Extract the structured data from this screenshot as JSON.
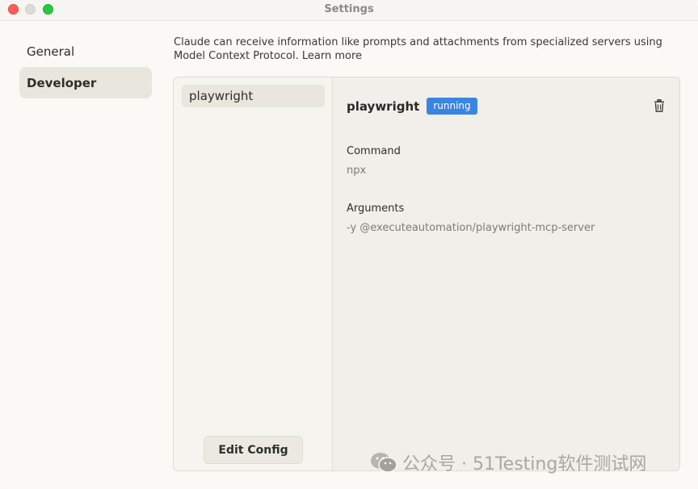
{
  "window": {
    "title": "Settings"
  },
  "sidebar": {
    "items": [
      {
        "label": "General",
        "active": false
      },
      {
        "label": "Developer",
        "active": true
      }
    ]
  },
  "intro": {
    "text": "Claude can receive information like prompts and attachments from specialized servers using Model Context Protocol. Learn more"
  },
  "servers": {
    "items": [
      {
        "label": "playwright"
      }
    ],
    "edit_config_label": "Edit Config"
  },
  "detail": {
    "name": "playwright",
    "status": "running",
    "command_label": "Command",
    "command_value": "npx",
    "arguments_label": "Arguments",
    "arguments_value": "-y @executeautomation/playwright-mcp-server"
  },
  "watermark": {
    "text": "公众号 · 51Testing软件测试网"
  },
  "colors": {
    "accent_badge": "#3a85e3",
    "active_bg": "#e8e6dd"
  }
}
